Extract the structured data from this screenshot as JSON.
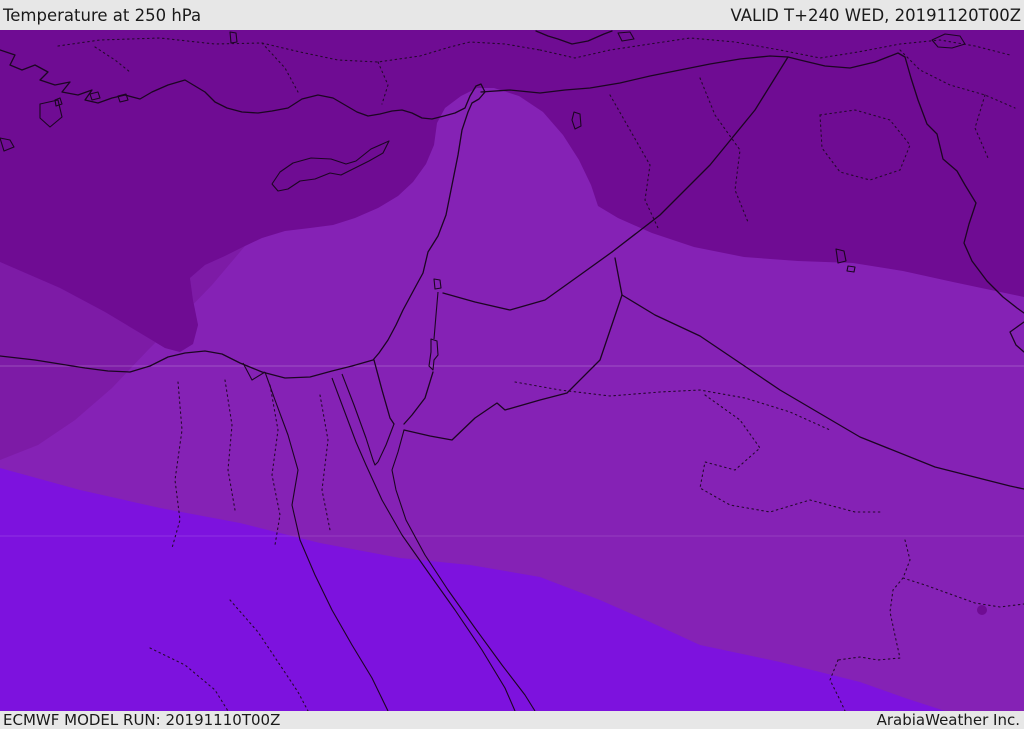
{
  "header": {
    "title": "Temperature at 250 hPa",
    "valid_label": "VALID T+240 WED, 20191120T00Z"
  },
  "footer": {
    "model_run": "ECMWF MODEL RUN: 20191110T00Z",
    "credit": "ArabiaWeather Inc."
  },
  "map": {
    "parameter": "Temperature",
    "level": "250 hPa",
    "region": "Eastern Mediterranean / Middle East",
    "bands": [
      {
        "name": "coldest-north",
        "color": "#6f0c93"
      },
      {
        "name": "very-cold-west",
        "color": "#7d1ba6"
      },
      {
        "name": "cold-central",
        "color": "#8522b5"
      },
      {
        "name": "milder-south",
        "color": "#7d12de"
      }
    ],
    "line_color": "#1c0522",
    "bar_background": "#e7e7e7"
  }
}
